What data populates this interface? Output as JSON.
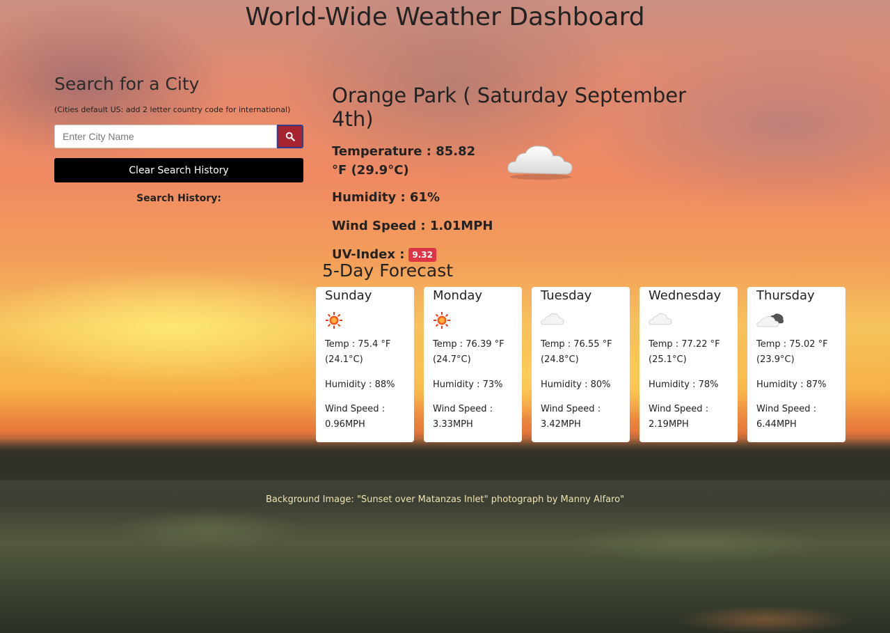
{
  "header": {
    "title": "World-Wide Weather Dashboard"
  },
  "search": {
    "heading": "Search for a City",
    "note": "(Cities default US: add 2 letter country code for international)",
    "placeholder": "Enter City Name",
    "value": "",
    "clear_label": "Clear Search History",
    "history_label": "Search History:",
    "search_icon": "search-icon"
  },
  "current": {
    "heading": "Orange Park ( Saturday September 4th)",
    "temperature": "Temperature : 85.82 °F (29.9°C)",
    "humidity": "Humidity : 61%",
    "wind": "Wind Speed : 1.01MPH",
    "uv_label": "UV-Index :",
    "uv_value": "9.32",
    "icon": "cloud-icon"
  },
  "forecast": {
    "heading": "5-Day Forecast",
    "days": [
      {
        "day": "Sunday",
        "icon": "sun-icon",
        "temp": "Temp : 75.4 °F (24.1°C)",
        "humidity": "Humidity : 88%",
        "wind": "Wind Speed : 0.96MPH"
      },
      {
        "day": "Monday",
        "icon": "sun-icon",
        "temp": "Temp : 76.39 °F (24.7°C)",
        "humidity": "Humidity : 73%",
        "wind": "Wind Speed : 3.33MPH"
      },
      {
        "day": "Tuesday",
        "icon": "cloud-icon",
        "temp": "Temp : 76.55 °F (24.8°C)",
        "humidity": "Humidity : 80%",
        "wind": "Wind Speed : 3.42MPH"
      },
      {
        "day": "Wednesday",
        "icon": "cloud-icon",
        "temp": "Temp : 77.22 °F (25.1°C)",
        "humidity": "Humidity : 78%",
        "wind": "Wind Speed : 2.19MPH"
      },
      {
        "day": "Thursday",
        "icon": "broken-clouds-icon",
        "temp": "Temp : 75.02 °F (23.9°C)",
        "humidity": "Humidity : 87%",
        "wind": "Wind Speed : 6.44MPH"
      }
    ]
  },
  "footer": {
    "credit": "Background Image: \"Sunset over Matanzas Inlet\" photograph by Manny Alfaro\""
  },
  "colors": {
    "uv_badge": "#dc3545",
    "search_button": "#a5242f",
    "clear_button": "#000000"
  }
}
